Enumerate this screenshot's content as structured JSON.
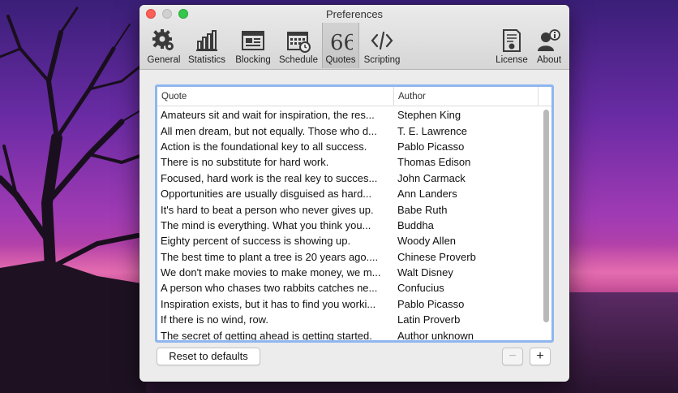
{
  "window": {
    "title": "Preferences"
  },
  "toolbar": {
    "items": [
      {
        "label": "General",
        "icon": "gear-icon"
      },
      {
        "label": "Statistics",
        "icon": "bar-chart-icon"
      },
      {
        "label": "Blocking",
        "icon": "browser-window-icon"
      },
      {
        "label": "Schedule",
        "icon": "calendar-icon"
      },
      {
        "label": "Quotes",
        "icon": "quote-icon",
        "selected": true
      },
      {
        "label": "Scripting",
        "icon": "code-icon"
      },
      {
        "label": "License",
        "icon": "certificate-icon"
      },
      {
        "label": "About",
        "icon": "person-info-icon"
      }
    ]
  },
  "table": {
    "headers": {
      "quote": "Quote",
      "author": "Author"
    },
    "rows": [
      {
        "quote": "Amateurs sit and wait for inspiration, the res...",
        "author": "Stephen King"
      },
      {
        "quote": "All men dream, but not equally. Those who d...",
        "author": "T. E. Lawrence"
      },
      {
        "quote": "Action is the foundational key to all success.",
        "author": "Pablo Picasso"
      },
      {
        "quote": "There is no substitute for hard work.",
        "author": "Thomas Edison"
      },
      {
        "quote": "Focused, hard work is the real key to succes...",
        "author": "John Carmack"
      },
      {
        "quote": "Opportunities are usually disguised as hard...",
        "author": "Ann Landers"
      },
      {
        "quote": "It's hard to beat a person who never gives up.",
        "author": "Babe Ruth"
      },
      {
        "quote": "The mind is everything. What you think you...",
        "author": "Buddha"
      },
      {
        "quote": "Eighty percent of success is showing up.",
        "author": "Woody Allen"
      },
      {
        "quote": "The best time to plant a tree is 20 years ago....",
        "author": "Chinese Proverb"
      },
      {
        "quote": "We don't make movies to make money, we m...",
        "author": "Walt Disney"
      },
      {
        "quote": "A person who chases two rabbits catches ne...",
        "author": "Confucius"
      },
      {
        "quote": "Inspiration exists, but it has to find you worki...",
        "author": "Pablo Picasso"
      },
      {
        "quote": "If there is no wind, row.",
        "author": "Latin Proverb"
      },
      {
        "quote": "The secret of getting ahead is getting started.",
        "author": "Author unknown"
      }
    ]
  },
  "buttons": {
    "reset": "Reset to defaults",
    "minus": "−",
    "plus": "+"
  },
  "colors": {
    "focus_ring": "#8fb6ef",
    "close": "#fc5f57",
    "maximize": "#34c84a"
  }
}
